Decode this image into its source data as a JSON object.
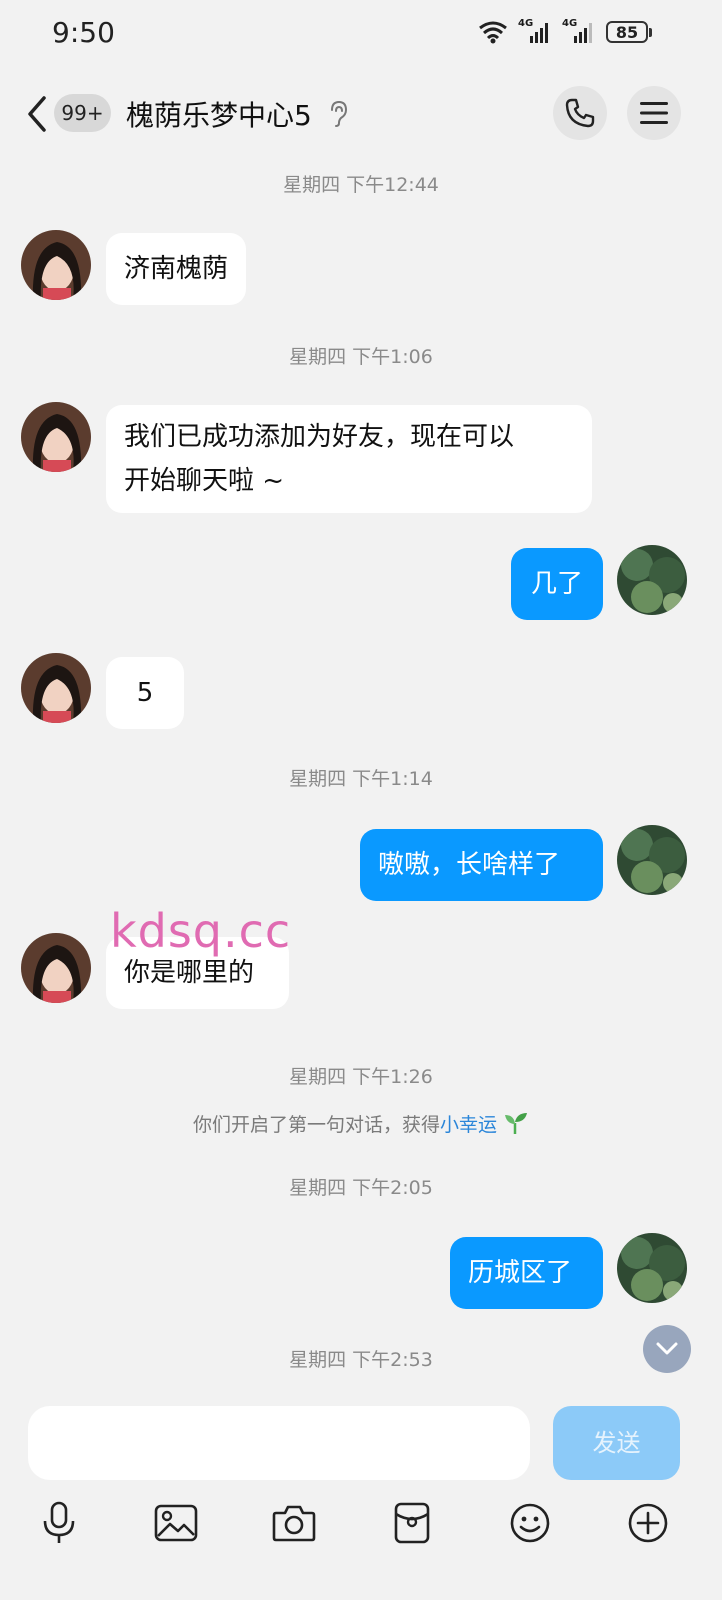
{
  "status_bar": {
    "time": "9:50",
    "network_1": "4G",
    "network_2": "4G",
    "battery": "85"
  },
  "header": {
    "unread_count": "99+",
    "title": "槐荫乐梦中心5"
  },
  "messages": {
    "ts1": "星期四 下午12:44",
    "m1": "济南槐荫",
    "ts2": "星期四 下午1:06",
    "m2_line1": "我们已成功添加为好友，现在可以",
    "m2_line2": "开始聊天啦 ~",
    "m3": "几了",
    "m4": "5",
    "ts3": "星期四 下午1:14",
    "m5": "嗷嗷，长啥样了",
    "m6": "你是哪里的",
    "ts4": "星期四 下午1:26",
    "system_note_prefix": "你们开启了第一句对话，获得",
    "system_note_link": "小幸运",
    "ts5": "星期四 下午2:05",
    "m7": "历城区了",
    "ts6": "星期四 下午2:53"
  },
  "watermark": "kdsq.cc",
  "input": {
    "value": "",
    "send_label": "发送"
  },
  "icons": {
    "back": "chevron-left-icon",
    "ear": "ear-icon",
    "call": "phone-icon",
    "menu": "menu-icon",
    "scroll": "chevron-down-icon",
    "toolbar": [
      "microphone-icon",
      "image-icon",
      "camera-icon",
      "red-packet-icon",
      "emoji-icon",
      "plus-icon"
    ]
  },
  "colors": {
    "outgoing_bubble": "#0a99ff",
    "incoming_bubble": "#ffffff",
    "background": "#f2f2f2",
    "link": "#2b86d9",
    "send_button": "#8ccaf8"
  }
}
